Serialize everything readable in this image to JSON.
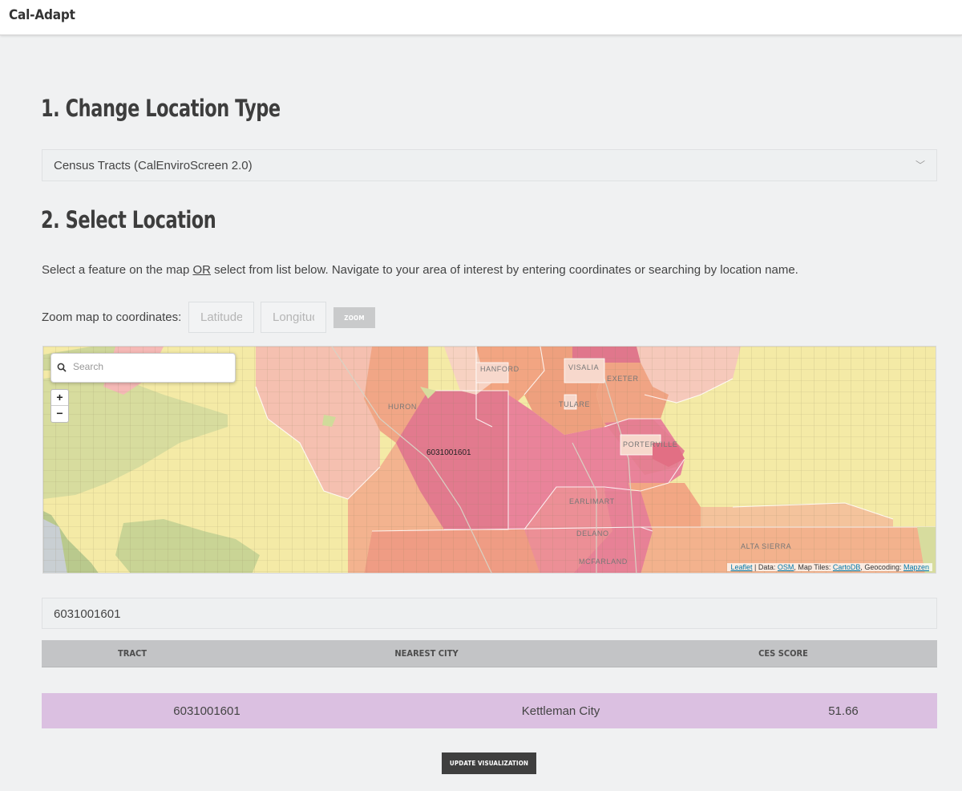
{
  "app": {
    "title": "Cal-Adapt"
  },
  "section1": {
    "heading": "1. Change Location Type",
    "location_type": {
      "selected": "Census Tracts (CalEnviroScreen 2.0)"
    }
  },
  "section2": {
    "heading": "2. Select Location",
    "instructions_before": "Select a feature on the map ",
    "instructions_or": "OR",
    "instructions_after": " select from list below. Navigate to your area of interest by entering coordinates or searching by location name.",
    "zoom_label": "Zoom map to coordinates:",
    "latitude_placeholder": "Latitude",
    "longitude_placeholder": "Longitude",
    "zoom_button": "ZOOM"
  },
  "map": {
    "search_placeholder": "Search",
    "zoom_in": "+",
    "zoom_out": "−",
    "feature_label": "6031001601",
    "place_labels": [
      "HANFORD",
      "VISALIA",
      "HURON",
      "TULARE",
      "EXETER",
      "PORTERVILLE",
      "EARLIMART",
      "DELANO",
      "MCFARLAND",
      "ALTA SIERRA"
    ],
    "attribution": {
      "leaflet": "Leaflet",
      "data_prefix": " | Data: ",
      "osm": "OSM",
      "tiles_prefix": ", Map Tiles: ",
      "cartodb": "CartoDB",
      "geocoding_prefix": ", Geocoding: ",
      "mapzen": "Mapzen"
    }
  },
  "selected_value": "6031001601",
  "table": {
    "headers": [
      "TRACT",
      "NEAREST CITY",
      "CES SCORE"
    ],
    "rows": [
      {
        "tract": "6031001601",
        "city": "Kettleman City",
        "score": "51.66"
      }
    ]
  },
  "update_button": "UPDATE VISUALIZATION",
  "colors": {
    "background": "#f0f1f2",
    "selected_row": "#dbc0e1",
    "table_header": "#c3c4c6",
    "update_button": "#3f3f3f",
    "map_low": "#f4eaa6",
    "map_mid": "#f3b08c",
    "map_high": "#e1738b"
  }
}
